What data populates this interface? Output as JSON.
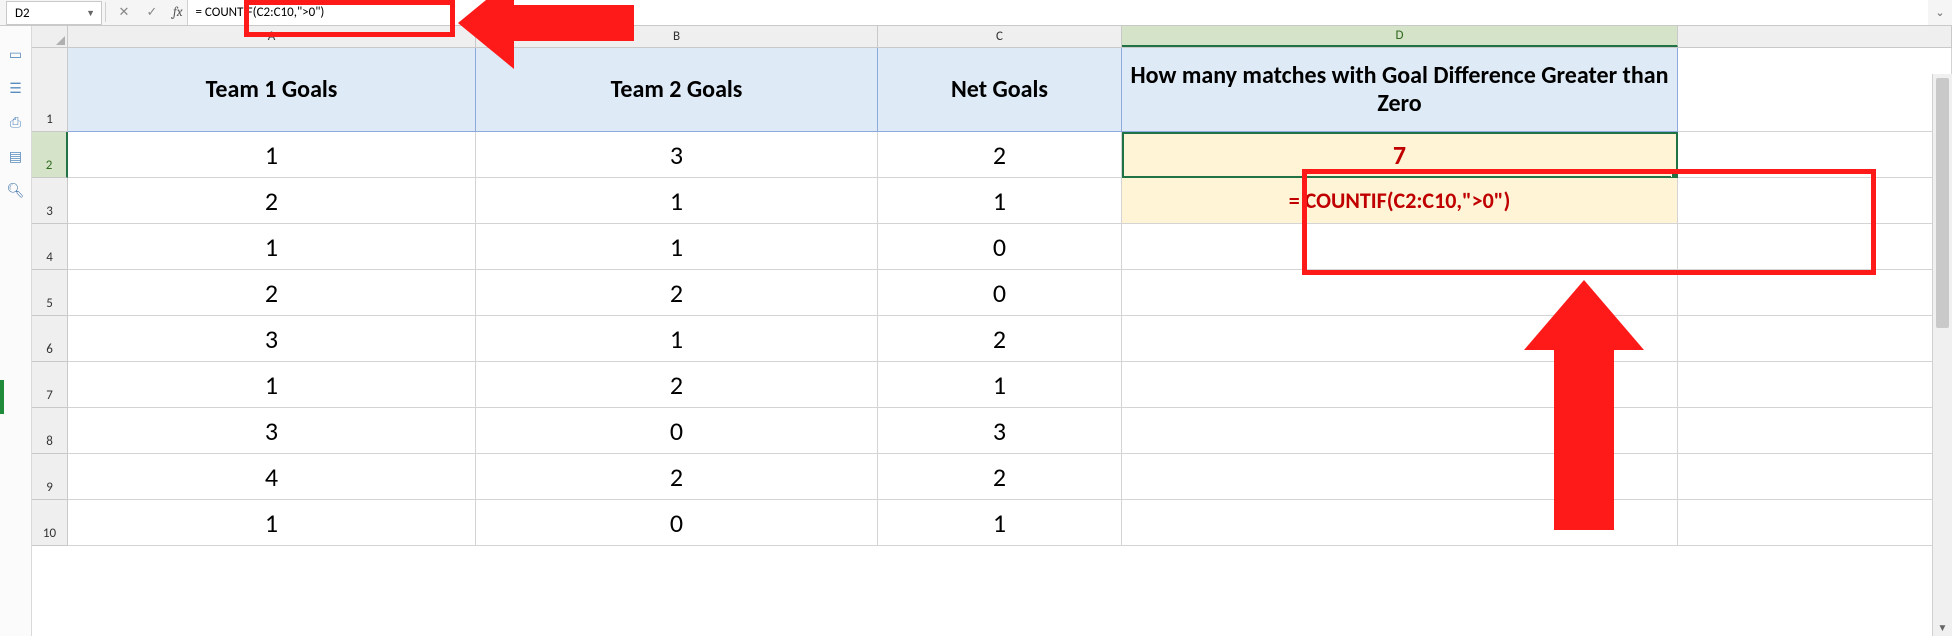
{
  "formula_bar": {
    "name_box": "D2",
    "fx_label": "fx",
    "formula": "= COUNTIF(C2:C10,\">0\")"
  },
  "columns": {
    "A": "A",
    "B": "B",
    "C": "C",
    "D": "D"
  },
  "row_numbers": [
    "1",
    "2",
    "3",
    "4",
    "5",
    "6",
    "7",
    "8",
    "9",
    "10"
  ],
  "headers": {
    "A": "Team 1 Goals",
    "B": "Team 2 Goals",
    "C": "Net Goals",
    "D": "How many matches with Goal Difference Greater than Zero"
  },
  "data": {
    "A": [
      "1",
      "2",
      "1",
      "2",
      "3",
      "1",
      "3",
      "4",
      "1"
    ],
    "B": [
      "3",
      "1",
      "1",
      "2",
      "1",
      "2",
      "0",
      "2",
      "0"
    ],
    "C": [
      "2",
      "1",
      "0",
      "0",
      "2",
      "1",
      "3",
      "2",
      "1"
    ]
  },
  "d2_value": "7",
  "d3_value": "= COUNTIF(C2:C10,\">0\")",
  "chart_data": {
    "type": "table",
    "title": "",
    "columns": [
      "Team 1 Goals",
      "Team 2 Goals",
      "Net Goals",
      "How many matches with Goal Difference Greater than Zero"
    ],
    "rows": [
      [
        1,
        3,
        2,
        7
      ],
      [
        2,
        1,
        1,
        null
      ],
      [
        1,
        1,
        0,
        null
      ],
      [
        2,
        2,
        0,
        null
      ],
      [
        3,
        1,
        2,
        null
      ],
      [
        1,
        2,
        1,
        null
      ],
      [
        3,
        0,
        3,
        null
      ],
      [
        4,
        2,
        2,
        null
      ],
      [
        1,
        0,
        1,
        null
      ]
    ]
  }
}
